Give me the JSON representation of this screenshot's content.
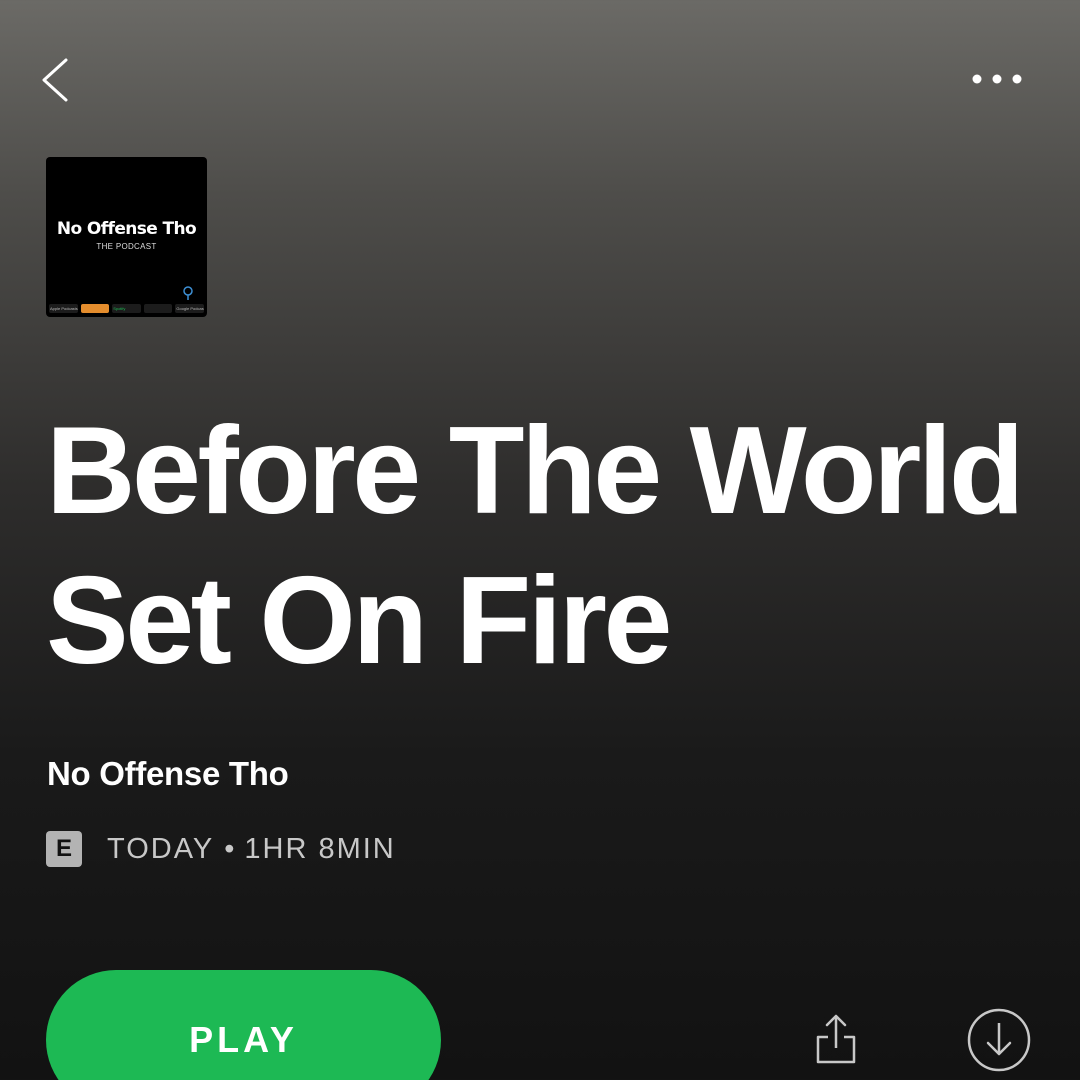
{
  "header": {
    "back_icon": "chevron-left-icon",
    "more_icon": "more-horizontal-icon"
  },
  "cover": {
    "title": "No Offense Tho",
    "subtitle": "THE PODCAST",
    "badges": [
      "Apple Podcasts",
      "",
      "Spotify",
      "",
      "Google Podcasts"
    ]
  },
  "episode": {
    "title": "Before The World Set On Fire",
    "show_name": "No Offense Tho",
    "explicit_label": "E",
    "date": "TODAY",
    "separator": "•",
    "duration": "1HR 8MIN"
  },
  "actions": {
    "play_label": "PLAY",
    "share_icon": "share-icon",
    "download_icon": "download-icon"
  },
  "colors": {
    "accent": "#1db954",
    "background_top": "#6b6a66",
    "background_bottom": "#121212",
    "text_primary": "#ffffff",
    "text_secondary": "#c8c8c8"
  }
}
